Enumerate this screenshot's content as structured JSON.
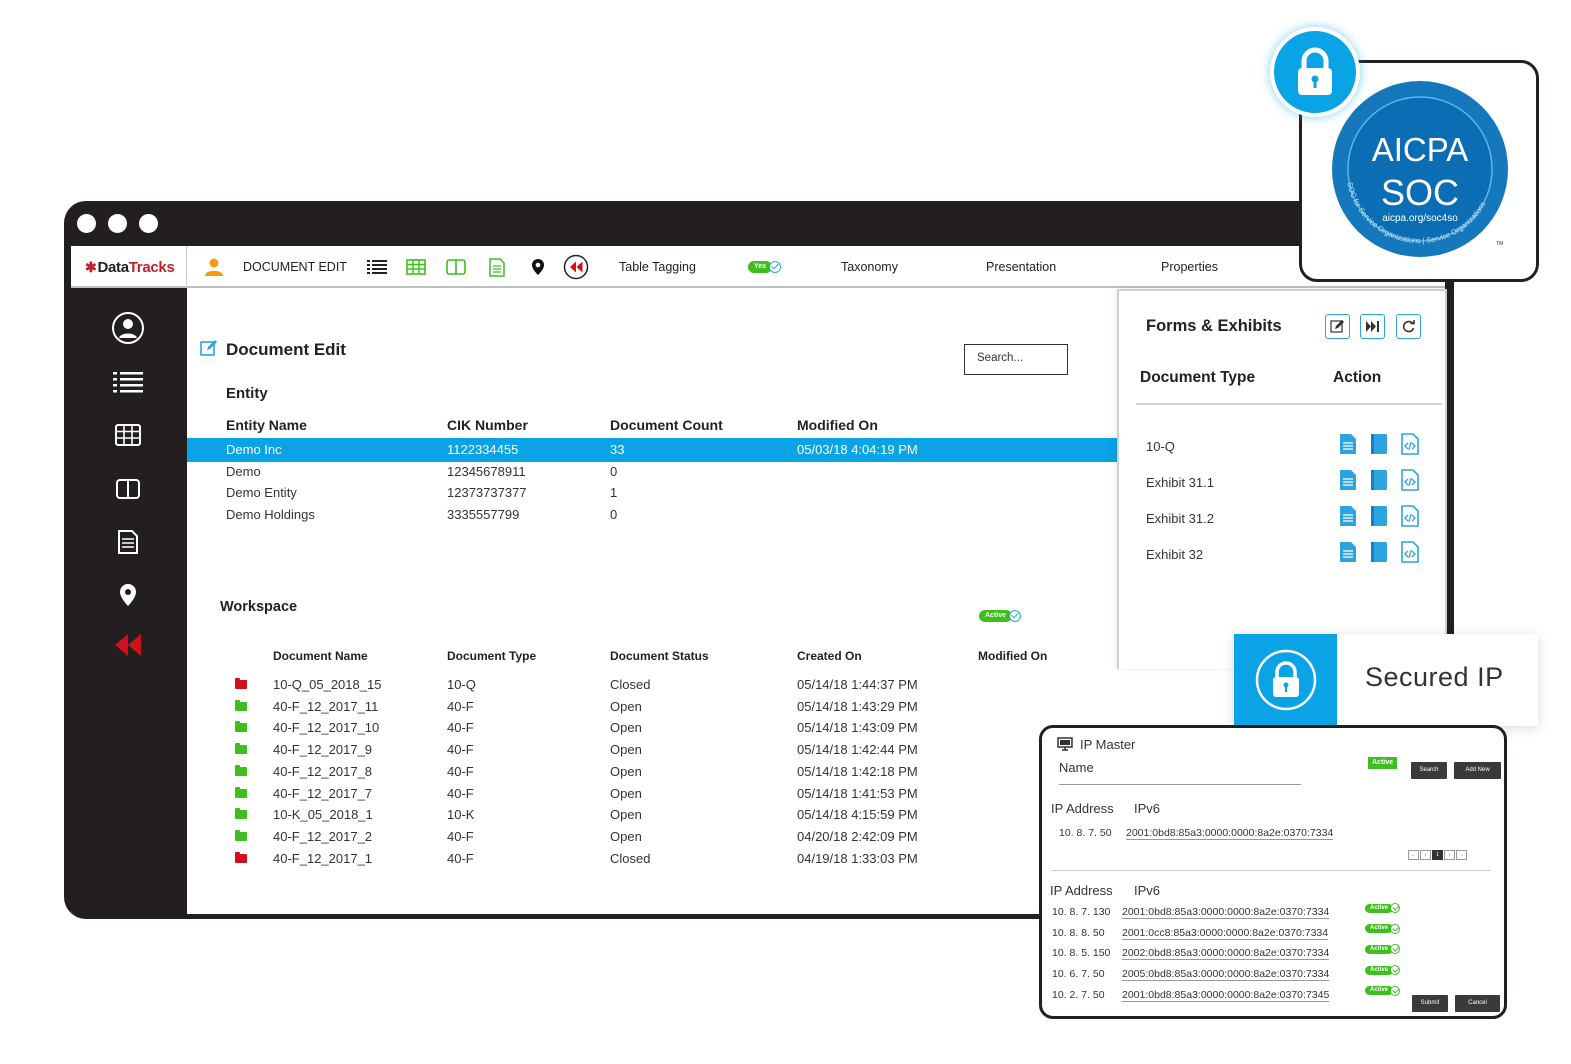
{
  "topbar": {
    "logo_brand": "Data",
    "logo_brand2": "Tracks",
    "document_edit": "DOCUMENT EDIT",
    "table_tagging": "Table Tagging",
    "toggle_yes": "Yes",
    "taxonomy": "Taxonomy",
    "presentation": "Presentation",
    "properties": "Properties"
  },
  "main": {
    "title": "Document Edit",
    "search_placeholder": "Search...",
    "entity_section": "Entity",
    "entity_columns": [
      "Entity Name",
      "CIK Number",
      "Document Count",
      "Modified On"
    ],
    "entities": [
      {
        "name": "Demo Inc",
        "cik": "1122334455",
        "count": "33",
        "modified": "05/03/18 4:04:19 PM",
        "selected": true
      },
      {
        "name": "Demo",
        "cik": "12345678911",
        "count": "0",
        "modified": ""
      },
      {
        "name": "Demo Entity",
        "cik": "12373737377",
        "count": "1",
        "modified": ""
      },
      {
        "name": "Demo Holdings",
        "cik": "3335557799",
        "count": "0",
        "modified": ""
      }
    ],
    "workspace_section": "Workspace",
    "workspace_toggle": "Active",
    "workspace_columns": [
      "Document Name",
      "Document Type",
      "Document Status",
      "Created On",
      "Modified On"
    ],
    "documents": [
      {
        "name": "10-Q_05_2018_15",
        "type": "10-Q",
        "status": "Closed",
        "created": "05/14/18 1:44:37 PM",
        "folder": "#d0101b"
      },
      {
        "name": "40-F_12_2017_11",
        "type": "40-F",
        "status": "Open",
        "created": "05/14/18 1:43:29 PM",
        "folder": "#3fbf1f"
      },
      {
        "name": "40-F_12_2017_10",
        "type": "40-F",
        "status": "Open",
        "created": "05/14/18 1:43:09 PM",
        "folder": "#3fbf1f"
      },
      {
        "name": "40-F_12_2017_9",
        "type": "40-F",
        "status": "Open",
        "created": "05/14/18 1:42:44 PM",
        "folder": "#3fbf1f"
      },
      {
        "name": "40-F_12_2017_8",
        "type": "40-F",
        "status": "Open",
        "created": "05/14/18 1:42:18 PM",
        "folder": "#3fbf1f"
      },
      {
        "name": "40-F_12_2017_7",
        "type": "40-F",
        "status": "Open",
        "created": "05/14/18 1:41:53 PM",
        "folder": "#3fbf1f"
      },
      {
        "name": "10-K_05_2018_1",
        "type": "10-K",
        "status": "Open",
        "created": "05/14/18 4:15:59 PM",
        "folder": "#3fbf1f"
      },
      {
        "name": "40-F_12_2017_2",
        "type": "40-F",
        "status": "Open",
        "created": "04/20/18 2:42:09 PM",
        "folder": "#3fbf1f"
      },
      {
        "name": "40-F_12_2017_1",
        "type": "40-F",
        "status": "Closed",
        "created": "04/19/18 1:33:03 PM",
        "folder": "#d0101b"
      }
    ]
  },
  "forms": {
    "title": "Forms & Exhibits",
    "col_doc_type": "Document Type",
    "col_action": "Action",
    "rows": [
      "10-Q",
      "Exhibit 31.1",
      "Exhibit 31.2",
      "Exhibit 32"
    ]
  },
  "badge": {
    "line1": "AICPA",
    "line2": "SOC",
    "url": "aicpa.org/soc4so",
    "ring_text": "SOC for Service Organizations | Service Organizations",
    "tm": "TM"
  },
  "secured": {
    "label": "Secured IP"
  },
  "ip_master": {
    "title": "IP Master",
    "name_label": "Name",
    "active": "Active",
    "search_btn": "Search",
    "add_btn": "Add New",
    "ip_label": "IP Address",
    "ipv6_label": "IPv6",
    "top_ip": "10. 8. 7. 50",
    "top_ipv6": "2001:0bd8:85a3:0000:0000:8a2e:0370:7334",
    "pager": [
      "←",
      "‹",
      "1",
      "›",
      "→"
    ],
    "rows": [
      {
        "ip": "10. 8. 7. 130",
        "ipv6": "2001:0bd8:85a3:0000:0000:8a2e:0370:7334"
      },
      {
        "ip": "10. 8. 8. 50",
        "ipv6": "2001:0cc8:85a3:0000:0000:8a2e:0370:7334"
      },
      {
        "ip": "10. 8. 5. 150",
        "ipv6": "2002:0bd8:85a3:0000:0000:8a2e:0370:7334"
      },
      {
        "ip": "10. 6. 7. 50",
        "ipv6": "2005:0bd8:85a3:0000:0000:8a2e:0370:7334"
      },
      {
        "ip": "10. 2. 7. 50",
        "ipv6": "2001:0bd8:85a3:0000:0000:8a2e:0370:7345"
      }
    ],
    "submit_btn": "Submit",
    "cancel_btn": "Cancel"
  },
  "colors": {
    "accent": "#0aa3e6",
    "dark": "#231f20",
    "green": "#3fbf1f",
    "red": "#d0101b"
  }
}
